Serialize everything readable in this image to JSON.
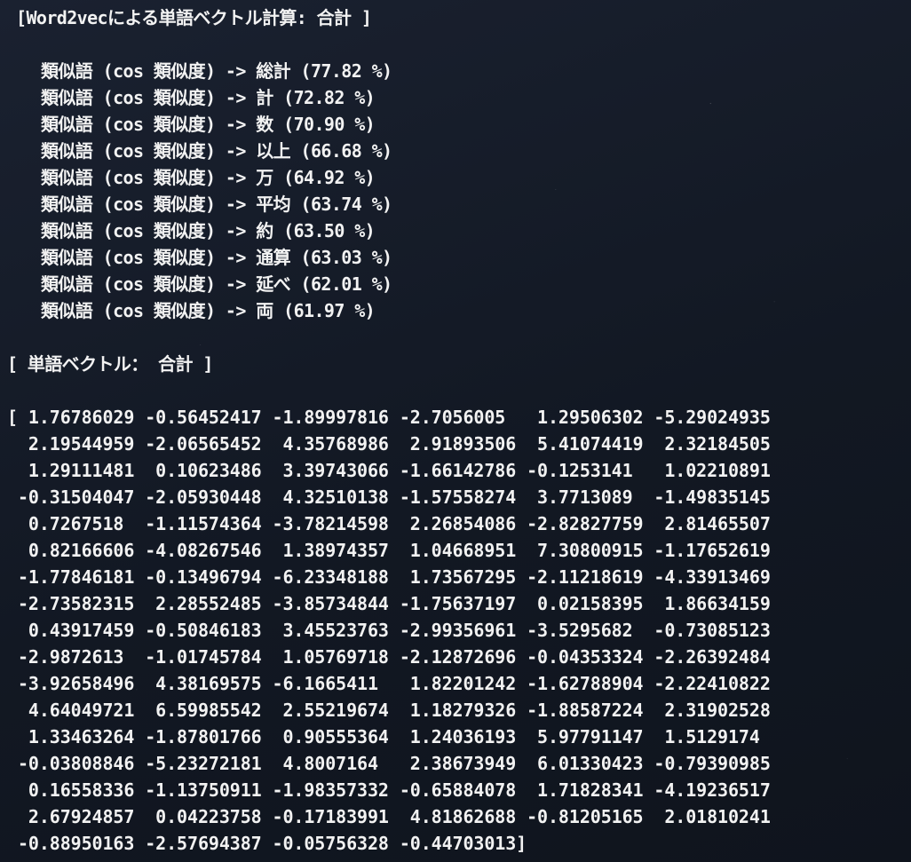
{
  "terminal": {
    "title": "[Word2vecによる単語ベクトル計算: 合計 ]",
    "similar_label": "類似語 (cos 類似度) ->",
    "similar_words": [
      {
        "word": "総計",
        "score": "(77.82 %)"
      },
      {
        "word": "計",
        "score": "(72.82 %)"
      },
      {
        "word": "数",
        "score": "(70.90 %)"
      },
      {
        "word": "以上",
        "score": "(66.68 %)"
      },
      {
        "word": "万",
        "score": "(64.92 %)"
      },
      {
        "word": "平均",
        "score": "(63.74 %)"
      },
      {
        "word": "約",
        "score": "(63.50 %)"
      },
      {
        "word": "通算",
        "score": "(63.03 %)"
      },
      {
        "word": "延べ",
        "score": "(62.01 %)"
      },
      {
        "word": "両",
        "score": "(61.97 %)"
      }
    ],
    "vector_header": "[ 単語ベクトル： 合計 ]",
    "vector_rows": [
      "[ 1.76786029 -0.56452417 -1.89997816 -2.7056005   1.29506302 -5.29024935",
      "  2.19544959 -2.06565452  4.35768986  2.91893506  5.41074419  2.32184505",
      "  1.29111481  0.10623486  3.39743066 -1.66142786 -0.1253141   1.02210891",
      " -0.31504047 -2.05930448  4.32510138 -1.57558274  3.7713089  -1.49835145",
      "  0.7267518  -1.11574364 -3.78214598  2.26854086 -2.82827759  2.81465507",
      "  0.82166606 -4.08267546  1.38974357  1.04668951  7.30800915 -1.17652619",
      " -1.77846181 -0.13496794 -6.23348188  1.73567295 -2.11218619 -4.33913469",
      " -2.73582315  2.28552485 -3.85734844 -1.75637197  0.02158395  1.86634159",
      "  0.43917459 -0.50846183  3.45523763 -2.99356961 -3.5295682  -0.73085123",
      " -2.9872613  -1.01745784  1.05769718 -2.12872696 -0.04353324 -2.26392484",
      " -3.92658496  4.38169575 -6.1665411   1.82201242 -1.62788904 -2.22410822",
      "  4.64049721  6.59985542  2.55219674  1.18279326 -1.88587224  2.31902528",
      "  1.33463264 -1.87801766  0.90555364  1.24036193  5.97791147  1.5129174",
      " -0.03808846 -5.23272181  4.8007164   2.38673949  6.01330423 -0.79390985",
      "  0.16558336 -1.13750911 -1.98357332 -0.65884078  1.71828341 -4.19236517",
      "  2.67924857  0.04223758 -0.17183991  4.81862688 -0.81205165  2.01810241",
      " -0.88950163 -2.57694387 -0.05756328 -0.44703013]"
    ]
  }
}
